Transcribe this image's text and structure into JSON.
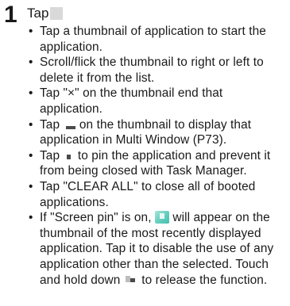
{
  "step": {
    "number": "1",
    "heading": "Tap",
    "heading_icon": "recent-apps-icon"
  },
  "bullets": [
    {
      "text": "Tap a thumbnail of application to start the application."
    },
    {
      "text": "Scroll/flick the thumbnail to right or left to delete it from the list."
    },
    {
      "text": "Tap \"×\" on the thumbnail end that application."
    },
    {
      "before": "Tap ",
      "icon": "multi-window-icon",
      "after": " on the thumbnail to display that application in Multi Window (P73)."
    },
    {
      "before": "Tap ",
      "icon": "pin-icon",
      "after": " to pin the application and prevent it from being closed with Task Manager."
    },
    {
      "text": "Tap \"CLEAR ALL\" to close all of booted applications."
    },
    {
      "before": "If \"Screen pin\" is on, ",
      "icon": "screen-pin-icon",
      "middle": " will appear on the thumbnail of the most recently displayed application. Tap it to disable the use of any application other than the selected. Touch and hold down ",
      "icon2": "back-recent-icon",
      "after": " to release the function."
    }
  ],
  "colors": {
    "text": "#1a1a1a",
    "screen_pin_icon": "#5cc8b8"
  }
}
